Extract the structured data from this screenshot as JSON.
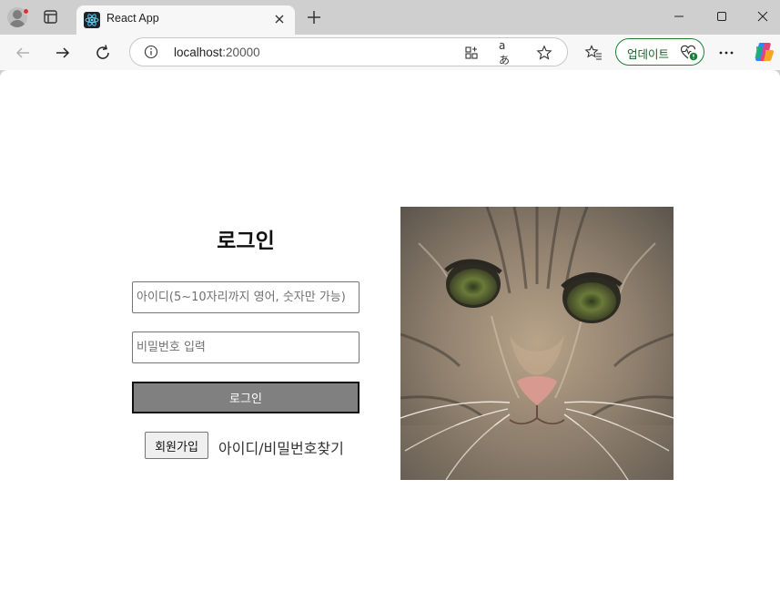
{
  "browser": {
    "tab": {
      "title": "React App"
    },
    "address": {
      "host": "localhost",
      "port": ":20000"
    },
    "update_label": "업데이트"
  },
  "icons": [
    "profile-icon",
    "tab-actions-icon",
    "react-favicon",
    "close-icon",
    "plus-icon",
    "minimize-icon",
    "maximize-icon",
    "window-close-icon",
    "back-icon",
    "forward-icon",
    "refresh-icon",
    "info-icon",
    "app-icon",
    "read-aloud-icon",
    "star-icon",
    "favorites-icon",
    "heartbeat-icon",
    "more-icon",
    "copilot-icon"
  ],
  "translate_glyph": "aあ",
  "login": {
    "title": "로그인",
    "id_placeholder": "아이디(5~10자리까지 영어, 숫자만 가능)",
    "password_placeholder": "비밀번호 입력",
    "submit_label": "로그인",
    "signup_label": "회원가입",
    "find_label": "아이디/비밀번호찾기"
  },
  "colors": {
    "accent_update": "#1a7f37",
    "login_button_bg": "#808080"
  }
}
